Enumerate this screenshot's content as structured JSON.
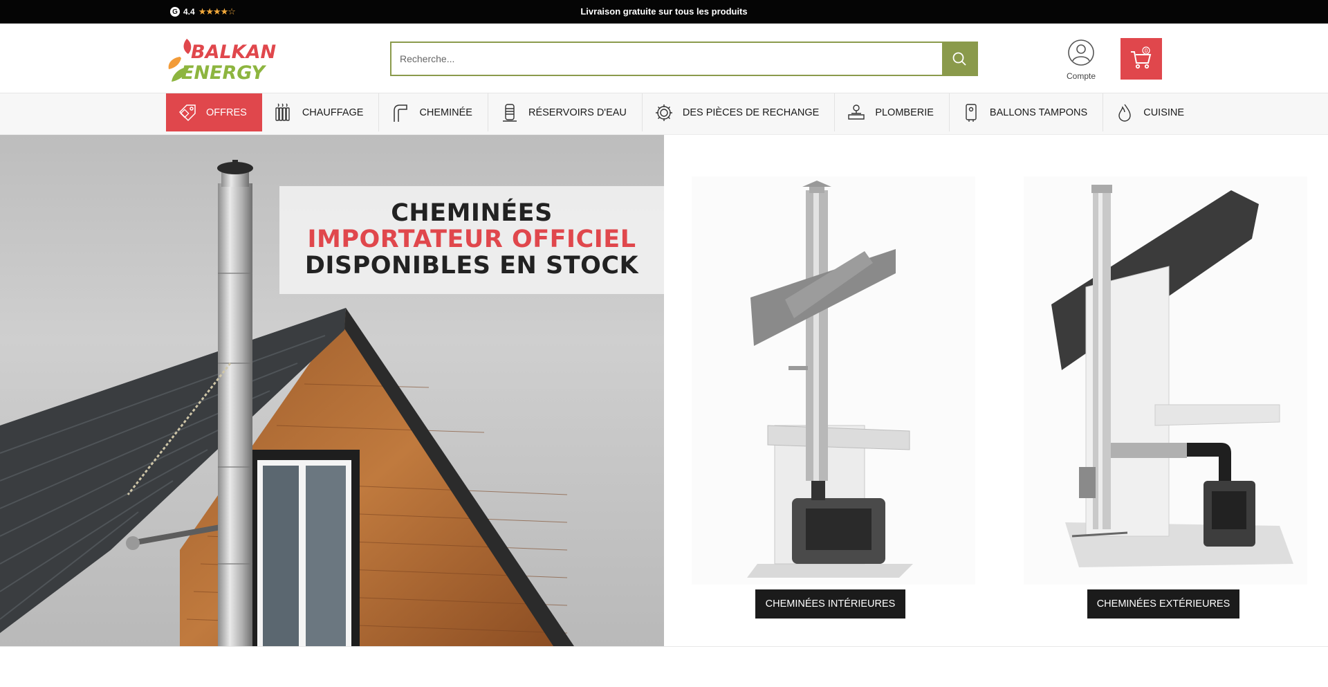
{
  "topbar": {
    "rating_badge": "G",
    "rating_value": "4.4",
    "rating_stars": "★★★★☆",
    "announcement": "Livraison gratuite sur tous les produits"
  },
  "header": {
    "logo_text": [
      "BALKAN",
      "ENERGY"
    ],
    "search_placeholder": "Recherche...",
    "account_label": "Compte",
    "cart_count": "0"
  },
  "nav": {
    "items": [
      {
        "label": "OFFRES",
        "icon": "tag-icon"
      },
      {
        "label": "CHAUFFAGE",
        "icon": "radiator-icon"
      },
      {
        "label": "CHEMINÉE",
        "icon": "chimney-pipe-icon"
      },
      {
        "label": "RÉSERVOIRS D'EAU",
        "icon": "water-tank-icon"
      },
      {
        "label": "DES PIÈCES DE RECHANGE",
        "icon": "gear-icon"
      },
      {
        "label": "PLOMBERIE",
        "icon": "valve-icon"
      },
      {
        "label": "BALLONS TAMPONS",
        "icon": "boiler-icon"
      },
      {
        "label": "CUISINE",
        "icon": "flame-icon"
      }
    ]
  },
  "hero": {
    "line1": "CHEMINÉES",
    "line2": "IMPORTATEUR OFFICIEL",
    "line3": "DISPONIBLES EN STOCK"
  },
  "products": [
    {
      "button": "CHEMINÉES INTÉRIEURES"
    },
    {
      "button": "CHEMINÉES EXTÉRIEURES"
    }
  ],
  "colors": {
    "accent_red": "#e0474c",
    "accent_green": "#8a9a4b",
    "topbar": "#050505"
  }
}
